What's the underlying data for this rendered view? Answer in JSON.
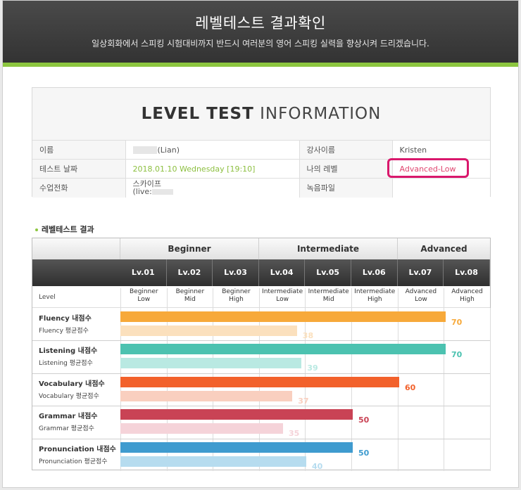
{
  "header": {
    "title": "레벨테스트 결과확인",
    "subtitle": "일상회화에서 스피킹 시험대비까지 반드시 여러분의 영어 스피킹 실력을 향상시켜 드리겠습니다."
  },
  "info": {
    "heading_bold": "LEVEL TEST",
    "heading_light": "INFORMATION",
    "rows": [
      {
        "label": "이름",
        "value": "(Lian)",
        "label2": "강사이름",
        "value2": "Kristen"
      },
      {
        "label": "테스트 날짜",
        "value": "2018.01.10  Wednesday [19:10]",
        "label2": "나의 레벨",
        "value2": "Advanced-Low"
      },
      {
        "label": "수업전화",
        "value": "스카이프",
        "value_line2": "(live:",
        "label2": "녹음파일",
        "value2": ""
      }
    ]
  },
  "section_title": "레벨테스트 결과",
  "result": {
    "groups": [
      "Beginner",
      "Intermediate",
      "Advanced"
    ],
    "levels": [
      "Lv.01",
      "Lv.02",
      "Lv.03",
      "Lv.04",
      "Lv.05",
      "Lv.06",
      "Lv.07",
      "Lv.08"
    ],
    "level_label": "Level",
    "level_names": [
      [
        "Beginner",
        "Low"
      ],
      [
        "Beginner",
        "Mid"
      ],
      [
        "Beginner",
        "High"
      ],
      [
        "Intermediate",
        "Low"
      ],
      [
        "Intermediate",
        "Mid"
      ],
      [
        "Intermediate",
        "High"
      ],
      [
        "Advanced",
        "Low"
      ],
      [
        "Advanced",
        "High"
      ]
    ],
    "skills": [
      {
        "name": "Fluency 내점수",
        "avg_label": "Fluency 평균점수",
        "my_score": 70,
        "avg_score": 38,
        "color": "#f7a93a",
        "avg_color": "#fbe0bd"
      },
      {
        "name": "Listening 내점수",
        "avg_label": "Listening 평균점수",
        "my_score": 70,
        "avg_score": 39,
        "color": "#4cc2b0",
        "avg_color": "#b9e9e2"
      },
      {
        "name": "Vocabulary 내점수",
        "avg_label": "Vocabulary 평균점수",
        "my_score": 60,
        "avg_score": 37,
        "color": "#f2612b",
        "avg_color": "#f9cfbf"
      },
      {
        "name": "Grammar 내점수",
        "avg_label": "Grammar 평균점수",
        "my_score": 50,
        "avg_score": 35,
        "color": "#c94355",
        "avg_color": "#f5d3d9"
      },
      {
        "name": "Pronunciation 내점수",
        "avg_label": "Pronunciation 평균점수",
        "my_score": 50,
        "avg_score": 40,
        "color": "#3f9bcf",
        "avg_color": "#b6dcef"
      }
    ]
  }
}
